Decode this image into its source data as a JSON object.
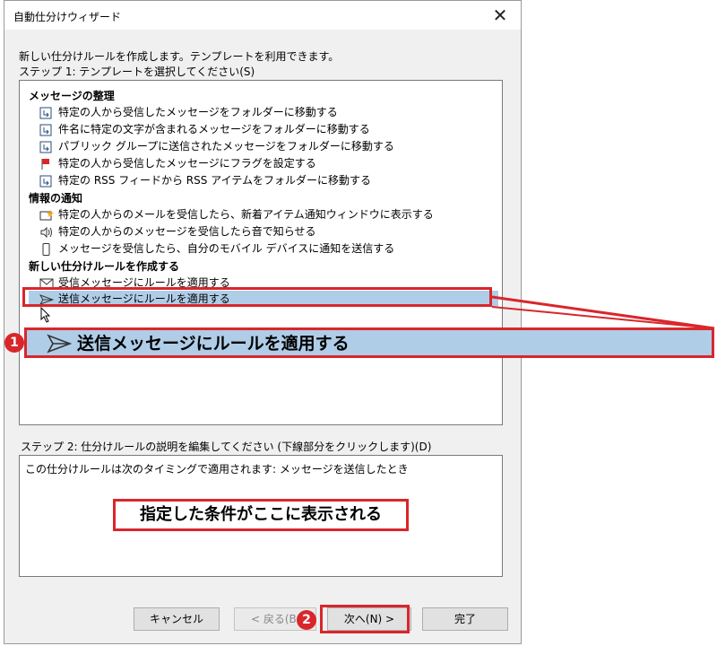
{
  "window": {
    "title": "自動仕分けウィザード",
    "close_glyph": "✕"
  },
  "intro": "新しい仕分けルールを作成します。テンプレートを利用できます。",
  "step1_label": "ステップ 1: テンプレートを選択してください(S)",
  "groups": [
    {
      "name": "メッセージの整理",
      "items": [
        {
          "label": "特定の人から受信したメッセージをフォルダーに移動する",
          "icon": "move-to-folder-icon"
        },
        {
          "label": "件名に特定の文字が含まれるメッセージをフォルダーに移動する",
          "icon": "move-to-folder-icon"
        },
        {
          "label": "パブリック グループに送信されたメッセージをフォルダーに移動する",
          "icon": "move-to-folder-icon"
        },
        {
          "label": "特定の人から受信したメッセージにフラグを設定する",
          "icon": "flag-icon"
        },
        {
          "label": "特定の RSS フィードから RSS アイテムをフォルダーに移動する",
          "icon": "move-to-folder-icon"
        }
      ]
    },
    {
      "name": "情報の通知",
      "items": [
        {
          "label": "特定の人からのメールを受信したら、新着アイテム通知ウィンドウに表示する",
          "icon": "new-item-alert-icon"
        },
        {
          "label": "特定の人からのメッセージを受信したら音で知らせる",
          "icon": "sound-icon"
        },
        {
          "label": "メッセージを受信したら、自分のモバイル デバイスに通知を送信する",
          "icon": "mobile-device-icon"
        }
      ]
    },
    {
      "name": "新しい仕分けルールを作成する",
      "items": [
        {
          "label": "受信メッセージにルールを適用する",
          "icon": "envelope-icon"
        },
        {
          "label": "送信メッセージにルールを適用する",
          "icon": "send-icon",
          "selected": true
        }
      ]
    }
  ],
  "callout_zoom_label": "送信メッセージにルールを適用する",
  "step2_label": "ステップ 2: 仕分けルールの説明を編集してください (下線部分をクリックします)(D)",
  "description": "この仕分けルールは次のタイミングで適用されます: メッセージを送信したとき",
  "callout_condition": "指定した条件がここに表示される",
  "buttons": {
    "cancel": "キャンセル",
    "back": "< 戻る(B",
    "next": "次へ(N) >",
    "finish": "完了"
  },
  "badges": {
    "one": "1",
    "two": "2"
  },
  "colors": {
    "accent_red": "#d9262b",
    "selection": "#b0cde8"
  }
}
